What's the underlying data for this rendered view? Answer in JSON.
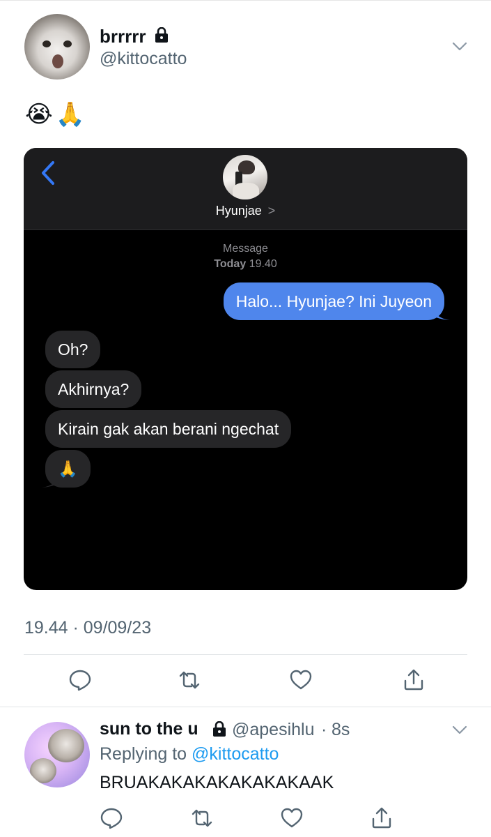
{
  "tweet": {
    "display_name": "brrrrr",
    "handle": "@kittocatto",
    "text": "😭🙏",
    "timestamp": "19.44 · 09/09/23",
    "icons": {
      "lock": "lock-icon",
      "menu": "chevron-down-icon",
      "actions": [
        "reply-icon",
        "retweet-icon",
        "like-icon",
        "share-icon"
      ]
    }
  },
  "screenshot": {
    "contact_name": "Hyunjae",
    "contact_chevron": ">",
    "meta_service": "Message",
    "meta_day": "Today",
    "meta_time": "19.40",
    "messages": [
      {
        "direction": "outgoing",
        "text": "Halo... Hyunjae? Ini Juyeon"
      },
      {
        "direction": "incoming",
        "text": "Oh?"
      },
      {
        "direction": "incoming",
        "text": "Akhirnya?"
      },
      {
        "direction": "incoming",
        "text": "Kirain gak akan berani ngechat"
      },
      {
        "direction": "incoming",
        "text": "🙏"
      }
    ],
    "colors": {
      "background": "#000000",
      "outgoing_bubble": "#4f86ec",
      "incoming_bubble": "#262628",
      "back_chevron": "#3478f6"
    }
  },
  "reply": {
    "display_name": "sun to the u",
    "handle": "@apesihlu",
    "separator": "·",
    "time": "8s",
    "replying_prefix": "Replying to",
    "replying_to": "@kittocatto",
    "text": "BRUAKAKAKAKAKAKAKAAK"
  },
  "colors": {
    "text": "#0f1419",
    "secondary": "#536471",
    "link": "#1d9bf0"
  }
}
